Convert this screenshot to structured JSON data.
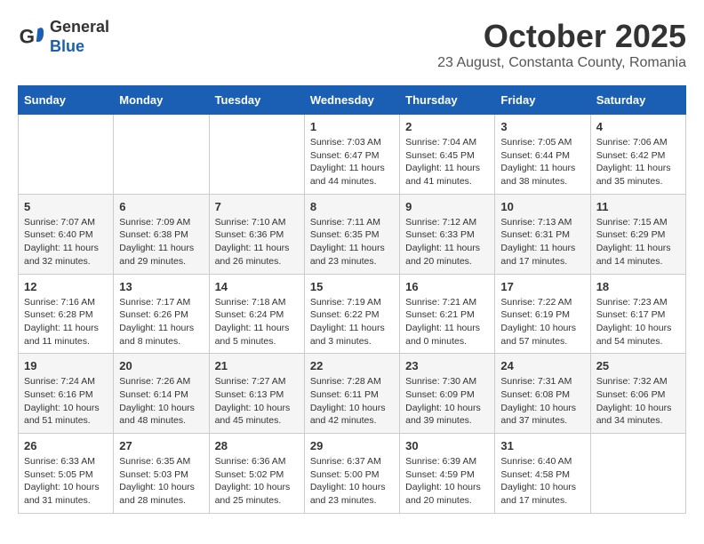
{
  "header": {
    "logo_line1": "General",
    "logo_line2": "Blue",
    "month_title": "October 2025",
    "subtitle": "23 August, Constanta County, Romania"
  },
  "weekdays": [
    "Sunday",
    "Monday",
    "Tuesday",
    "Wednesday",
    "Thursday",
    "Friday",
    "Saturday"
  ],
  "weeks": [
    [
      {
        "day": "",
        "info": ""
      },
      {
        "day": "",
        "info": ""
      },
      {
        "day": "",
        "info": ""
      },
      {
        "day": "1",
        "info": "Sunrise: 7:03 AM\nSunset: 6:47 PM\nDaylight: 11 hours\nand 44 minutes."
      },
      {
        "day": "2",
        "info": "Sunrise: 7:04 AM\nSunset: 6:45 PM\nDaylight: 11 hours\nand 41 minutes."
      },
      {
        "day": "3",
        "info": "Sunrise: 7:05 AM\nSunset: 6:44 PM\nDaylight: 11 hours\nand 38 minutes."
      },
      {
        "day": "4",
        "info": "Sunrise: 7:06 AM\nSunset: 6:42 PM\nDaylight: 11 hours\nand 35 minutes."
      }
    ],
    [
      {
        "day": "5",
        "info": "Sunrise: 7:07 AM\nSunset: 6:40 PM\nDaylight: 11 hours\nand 32 minutes."
      },
      {
        "day": "6",
        "info": "Sunrise: 7:09 AM\nSunset: 6:38 PM\nDaylight: 11 hours\nand 29 minutes."
      },
      {
        "day": "7",
        "info": "Sunrise: 7:10 AM\nSunset: 6:36 PM\nDaylight: 11 hours\nand 26 minutes."
      },
      {
        "day": "8",
        "info": "Sunrise: 7:11 AM\nSunset: 6:35 PM\nDaylight: 11 hours\nand 23 minutes."
      },
      {
        "day": "9",
        "info": "Sunrise: 7:12 AM\nSunset: 6:33 PM\nDaylight: 11 hours\nand 20 minutes."
      },
      {
        "day": "10",
        "info": "Sunrise: 7:13 AM\nSunset: 6:31 PM\nDaylight: 11 hours\nand 17 minutes."
      },
      {
        "day": "11",
        "info": "Sunrise: 7:15 AM\nSunset: 6:29 PM\nDaylight: 11 hours\nand 14 minutes."
      }
    ],
    [
      {
        "day": "12",
        "info": "Sunrise: 7:16 AM\nSunset: 6:28 PM\nDaylight: 11 hours\nand 11 minutes."
      },
      {
        "day": "13",
        "info": "Sunrise: 7:17 AM\nSunset: 6:26 PM\nDaylight: 11 hours\nand 8 minutes."
      },
      {
        "day": "14",
        "info": "Sunrise: 7:18 AM\nSunset: 6:24 PM\nDaylight: 11 hours\nand 5 minutes."
      },
      {
        "day": "15",
        "info": "Sunrise: 7:19 AM\nSunset: 6:22 PM\nDaylight: 11 hours\nand 3 minutes."
      },
      {
        "day": "16",
        "info": "Sunrise: 7:21 AM\nSunset: 6:21 PM\nDaylight: 11 hours\nand 0 minutes."
      },
      {
        "day": "17",
        "info": "Sunrise: 7:22 AM\nSunset: 6:19 PM\nDaylight: 10 hours\nand 57 minutes."
      },
      {
        "day": "18",
        "info": "Sunrise: 7:23 AM\nSunset: 6:17 PM\nDaylight: 10 hours\nand 54 minutes."
      }
    ],
    [
      {
        "day": "19",
        "info": "Sunrise: 7:24 AM\nSunset: 6:16 PM\nDaylight: 10 hours\nand 51 minutes."
      },
      {
        "day": "20",
        "info": "Sunrise: 7:26 AM\nSunset: 6:14 PM\nDaylight: 10 hours\nand 48 minutes."
      },
      {
        "day": "21",
        "info": "Sunrise: 7:27 AM\nSunset: 6:13 PM\nDaylight: 10 hours\nand 45 minutes."
      },
      {
        "day": "22",
        "info": "Sunrise: 7:28 AM\nSunset: 6:11 PM\nDaylight: 10 hours\nand 42 minutes."
      },
      {
        "day": "23",
        "info": "Sunrise: 7:30 AM\nSunset: 6:09 PM\nDaylight: 10 hours\nand 39 minutes."
      },
      {
        "day": "24",
        "info": "Sunrise: 7:31 AM\nSunset: 6:08 PM\nDaylight: 10 hours\nand 37 minutes."
      },
      {
        "day": "25",
        "info": "Sunrise: 7:32 AM\nSunset: 6:06 PM\nDaylight: 10 hours\nand 34 minutes."
      }
    ],
    [
      {
        "day": "26",
        "info": "Sunrise: 6:33 AM\nSunset: 5:05 PM\nDaylight: 10 hours\nand 31 minutes."
      },
      {
        "day": "27",
        "info": "Sunrise: 6:35 AM\nSunset: 5:03 PM\nDaylight: 10 hours\nand 28 minutes."
      },
      {
        "day": "28",
        "info": "Sunrise: 6:36 AM\nSunset: 5:02 PM\nDaylight: 10 hours\nand 25 minutes."
      },
      {
        "day": "29",
        "info": "Sunrise: 6:37 AM\nSunset: 5:00 PM\nDaylight: 10 hours\nand 23 minutes."
      },
      {
        "day": "30",
        "info": "Sunrise: 6:39 AM\nSunset: 4:59 PM\nDaylight: 10 hours\nand 20 minutes."
      },
      {
        "day": "31",
        "info": "Sunrise: 6:40 AM\nSunset: 4:58 PM\nDaylight: 10 hours\nand 17 minutes."
      },
      {
        "day": "",
        "info": ""
      }
    ]
  ]
}
